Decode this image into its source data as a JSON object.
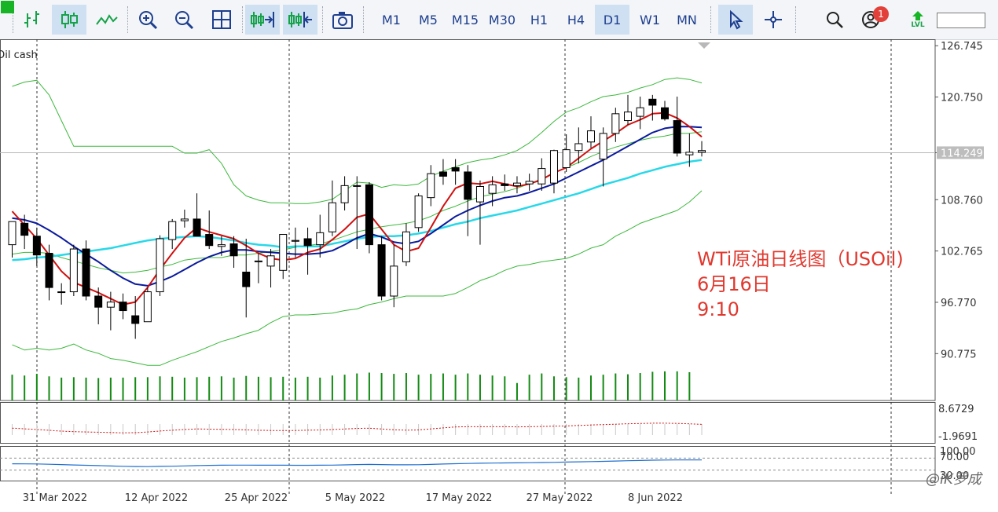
{
  "toolbar": {
    "timeframes": [
      "M1",
      "M5",
      "M15",
      "M30",
      "H1",
      "H4",
      "D1",
      "W1",
      "MN"
    ],
    "active_timeframe": "D1",
    "notification_count": "1",
    "level_label": "LVL",
    "level_fill": 0.28
  },
  "chart": {
    "symbol_label": "Oil cash",
    "current_price": "114.249",
    "price_axis_labels": [
      "126.745",
      "120.750",
      "114.249",
      "108.760",
      "102.765",
      "96.770",
      "90.775"
    ],
    "osc1_labels": [
      "8.6729",
      "-1.9691"
    ],
    "osc2_labels": [
      "100.00",
      "70.00",
      "30.00"
    ],
    "date_labels": [
      "31 Mar 2022",
      "12 Apr 2022",
      "25 Apr 2022",
      "5 May 2022",
      "17 May 2022",
      "27 May 2022",
      "8 Jun 2022"
    ],
    "annotation": [
      "WTi原油日线图（USOil)",
      "6月16日",
      "9:10"
    ],
    "watermark": "@iK罗成",
    "colors": {
      "ma_fast": "#d01010",
      "ma_mid": "#0a1a9c",
      "ma_slow": "#28d8e8",
      "bands": "#3cb83c",
      "volume": "#138a13",
      "annotation": "#e0382e"
    }
  },
  "chart_data": {
    "type": "candlestick",
    "x_dates": [
      "2022-03-28",
      "2022-03-29",
      "2022-03-30",
      "2022-03-31",
      "2022-04-01",
      "2022-04-04",
      "2022-04-05",
      "2022-04-06",
      "2022-04-07",
      "2022-04-08",
      "2022-04-11",
      "2022-04-12",
      "2022-04-13",
      "2022-04-14",
      "2022-04-18",
      "2022-04-19",
      "2022-04-20",
      "2022-04-21",
      "2022-04-22",
      "2022-04-25",
      "2022-04-26",
      "2022-04-27",
      "2022-04-28",
      "2022-04-29",
      "2022-05-02",
      "2022-05-03",
      "2022-05-04",
      "2022-05-05",
      "2022-05-06",
      "2022-05-09",
      "2022-05-10",
      "2022-05-11",
      "2022-05-12",
      "2022-05-13",
      "2022-05-16",
      "2022-05-17",
      "2022-05-18",
      "2022-05-19",
      "2022-05-20",
      "2022-05-23",
      "2022-05-24",
      "2022-05-25",
      "2022-05-26",
      "2022-05-27",
      "2022-05-30",
      "2022-05-31",
      "2022-06-01",
      "2022-06-02",
      "2022-06-03",
      "2022-06-06",
      "2022-06-07",
      "2022-06-08",
      "2022-06-09",
      "2022-06-10",
      "2022-06-13",
      "2022-06-14",
      "2022-06-15"
    ],
    "open": [
      103.5,
      106.0,
      104.5,
      102.5,
      98.0,
      98.0,
      103.0,
      97.5,
      96.2,
      96.8,
      95.2,
      94.5,
      98.0,
      104.1,
      106.3,
      106.5,
      104.7,
      103.3,
      103.6,
      100.3,
      101.5,
      101.0,
      100.5,
      103.9,
      104.2,
      103.5,
      105.0,
      108.4,
      110.4,
      110.5,
      103.5,
      97.5,
      101.5,
      105.5,
      109.0,
      112.0,
      112.5,
      112.0,
      108.5,
      109.5,
      110.6,
      110.4,
      110.6,
      110.6,
      110.7,
      112.5,
      114.5,
      115.5,
      113.5,
      116.5,
      118.0,
      118.5,
      120.5,
      119.5,
      118.0,
      114.0,
      114.3
    ],
    "high": [
      104.6,
      107.0,
      105.5,
      103.5,
      99.0,
      103.5,
      104.0,
      98.5,
      98.0,
      97.8,
      97.5,
      98.5,
      104.6,
      106.5,
      107.6,
      109.5,
      107.5,
      104.5,
      104.5,
      104.2,
      102.5,
      103.0,
      104.7,
      105.5,
      105.5,
      107.0,
      111.0,
      111.5,
      111.5,
      110.8,
      104.5,
      103.5,
      106.0,
      109.5,
      112.8,
      113.5,
      113.5,
      112.8,
      111.0,
      111.5,
      111.7,
      111.5,
      111.8,
      113.6,
      114.6,
      116.4,
      117.2,
      118.5,
      117.2,
      119.5,
      121.0,
      120.8,
      121.0,
      120.3,
      120.8,
      116.5,
      115.6
    ],
    "low": [
      102.0,
      103.0,
      101.0,
      97.0,
      96.5,
      97.5,
      97.0,
      94.2,
      93.5,
      94.8,
      92.5,
      94.5,
      97.5,
      103.0,
      105.5,
      104.5,
      103.0,
      102.2,
      100.8,
      95.0,
      99.0,
      98.5,
      99.5,
      102.0,
      100.0,
      102.0,
      104.5,
      107.5,
      103.0,
      102.5,
      97.0,
      96.2,
      101.0,
      105.0,
      108.0,
      110.5,
      110.5,
      104.5,
      103.5,
      108.0,
      109.8,
      109.5,
      109.8,
      109.8,
      109.5,
      112.0,
      113.0,
      114.8,
      110.3,
      115.5,
      117.5,
      117.0,
      118.0,
      118.0,
      113.8,
      112.6,
      113.8
    ],
    "close": [
      106.2,
      104.6,
      102.3,
      98.5,
      98.0,
      103.0,
      97.5,
      96.2,
      96.8,
      95.8,
      94.3,
      98.0,
      104.2,
      106.2,
      106.5,
      104.5,
      103.4,
      103.5,
      102.2,
      98.6,
      101.6,
      102.2,
      104.7,
      104.0,
      103.4,
      104.9,
      108.4,
      110.4,
      110.4,
      103.5,
      97.5,
      101.0,
      105.0,
      109.2,
      111.8,
      111.5,
      112.1,
      108.8,
      110.3,
      110.5,
      110.4,
      110.7,
      110.9,
      112.4,
      114.5,
      114.6,
      115.3,
      116.8,
      116.5,
      118.8,
      119.0,
      119.5,
      119.8,
      118.2,
      114.2,
      114.3,
      114.5
    ],
    "volume": [
      0.62,
      0.6,
      0.64,
      0.58,
      0.55,
      0.56,
      0.55,
      0.54,
      0.55,
      0.55,
      0.56,
      0.56,
      0.58,
      0.57,
      0.55,
      0.56,
      0.57,
      0.58,
      0.55,
      0.59,
      0.57,
      0.56,
      0.57,
      0.55,
      0.57,
      0.55,
      0.6,
      0.62,
      0.65,
      0.67,
      0.66,
      0.64,
      0.66,
      0.62,
      0.64,
      0.65,
      0.62,
      0.65,
      0.62,
      0.6,
      0.58,
      0.42,
      0.62,
      0.65,
      0.58,
      0.56,
      0.55,
      0.6,
      0.62,
      0.65,
      0.63,
      0.66,
      0.69,
      0.7,
      0.7,
      0.68,
      0.0
    ],
    "ma_fast": [
      107.4,
      105.8,
      104.2,
      102.3,
      100.4,
      99.1,
      98.5,
      97.9,
      97.2,
      96.5,
      96.8,
      98.5,
      100.6,
      102.5,
      104.3,
      105.5,
      105.0,
      104.6,
      104.2,
      103.4,
      102.5,
      101.9,
      101.7,
      101.9,
      102.6,
      103.0,
      104.1,
      105.3,
      106.7,
      107.1,
      105.3,
      103.5,
      102.7,
      103.1,
      105.5,
      108.0,
      110.1,
      110.7,
      110.6,
      110.9,
      110.6,
      110.3,
      110.6,
      111.1,
      111.9,
      112.5,
      113.6,
      114.7,
      115.6,
      116.5,
      117.5,
      118.1,
      118.8,
      118.9,
      118.3,
      117.3,
      116.1
    ],
    "ma_mid": [
      106.6,
      106.4,
      106.0,
      105.2,
      104.3,
      103.3,
      102.4,
      101.5,
      100.5,
      99.6,
      98.9,
      98.7,
      99.2,
      99.8,
      100.6,
      101.4,
      102.1,
      102.6,
      102.9,
      102.9,
      102.7,
      102.6,
      102.5,
      102.4,
      102.4,
      102.5,
      102.8,
      103.5,
      104.3,
      104.8,
      104.4,
      103.8,
      103.6,
      103.9,
      104.8,
      105.8,
      106.8,
      107.5,
      108.1,
      108.6,
      109.0,
      109.2,
      109.6,
      110.1,
      110.6,
      111.3,
      112.0,
      112.7,
      113.4,
      114.2,
      115.0,
      115.8,
      116.6,
      117.1,
      117.3,
      117.3,
      117.2
    ],
    "ma_slow": [
      101.7,
      101.8,
      102.0,
      102.1,
      102.3,
      102.5,
      102.7,
      102.9,
      103.1,
      103.4,
      103.7,
      104.0,
      104.2,
      104.3,
      104.4,
      104.5,
      104.4,
      104.2,
      104.0,
      103.7,
      103.5,
      103.4,
      103.2,
      103.3,
      103.3,
      103.3,
      103.6,
      103.9,
      104.2,
      104.4,
      104.5,
      104.5,
      104.6,
      104.8,
      105.1,
      105.5,
      105.9,
      106.2,
      106.6,
      106.9,
      107.2,
      107.5,
      107.9,
      108.3,
      108.7,
      109.1,
      109.5,
      110.0,
      110.5,
      110.9,
      111.3,
      111.8,
      112.2,
      112.6,
      112.9,
      113.2,
      113.4
    ],
    "bb_upper": [
      122.0,
      122.5,
      122.7,
      121.0,
      118.0,
      115.0,
      115.0,
      115.0,
      115.0,
      115.0,
      115.0,
      115.0,
      115.0,
      115.0,
      114.2,
      114.2,
      114.6,
      113.0,
      110.5,
      109.2,
      108.7,
      108.4,
      108.4,
      108.3,
      108.3,
      108.5,
      108.8,
      109.8,
      110.8,
      110.7,
      110.2,
      110.5,
      110.4,
      110.6,
      111.5,
      112.1,
      112.6,
      113.1,
      113.4,
      113.6,
      114.0,
      114.5,
      115.4,
      116.6,
      117.9,
      119.0,
      119.5,
      120.2,
      120.8,
      121.0,
      121.3,
      121.8,
      122.2,
      122.8,
      123.0,
      122.8,
      122.4
    ],
    "bb_mid": [
      102.4,
      102.6,
      102.6,
      102.5,
      102.0,
      101.6,
      101.2,
      100.8,
      100.5,
      100.2,
      100.3,
      100.5,
      100.9,
      101.2,
      101.7,
      101.9,
      102.0,
      102.0,
      102.3,
      102.3,
      102.5,
      102.7,
      102.9,
      103.2,
      103.4,
      103.6,
      104.0,
      104.5,
      105.0,
      105.3,
      105.6,
      105.8,
      106.0,
      106.3,
      106.8,
      107.5,
      108.0,
      108.6,
      109.1,
      109.4,
      109.7,
      110.1,
      110.6,
      111.2,
      111.9,
      112.5,
      113.1,
      113.8,
      114.4,
      114.9,
      115.3,
      115.7,
      116.0,
      116.2,
      116.5,
      116.5,
      116.7
    ],
    "bb_lower": [
      91.8,
      91.2,
      91.4,
      91.2,
      91.4,
      91.9,
      91.2,
      90.8,
      90.2,
      90.0,
      89.7,
      89.4,
      89.4,
      90.0,
      90.5,
      91.0,
      91.6,
      92.2,
      92.6,
      93.1,
      93.5,
      94.4,
      95.1,
      95.3,
      95.3,
      95.4,
      95.5,
      95.8,
      96.0,
      96.5,
      96.8,
      97.2,
      97.5,
      97.5,
      97.5,
      97.5,
      97.8,
      98.5,
      99.3,
      99.8,
      100.5,
      101.0,
      101.2,
      101.5,
      101.7,
      101.9,
      102.4,
      103.1,
      103.5,
      104.5,
      105.2,
      106.0,
      106.5,
      107.0,
      107.5,
      108.5,
      109.8
    ],
    "ylim": [
      85.3,
      127.5
    ],
    "osc1_range": [
      -1.9691,
      8.6729
    ],
    "osc2_range": [
      0,
      100
    ],
    "osc2_levels": [
      70,
      30
    ]
  }
}
